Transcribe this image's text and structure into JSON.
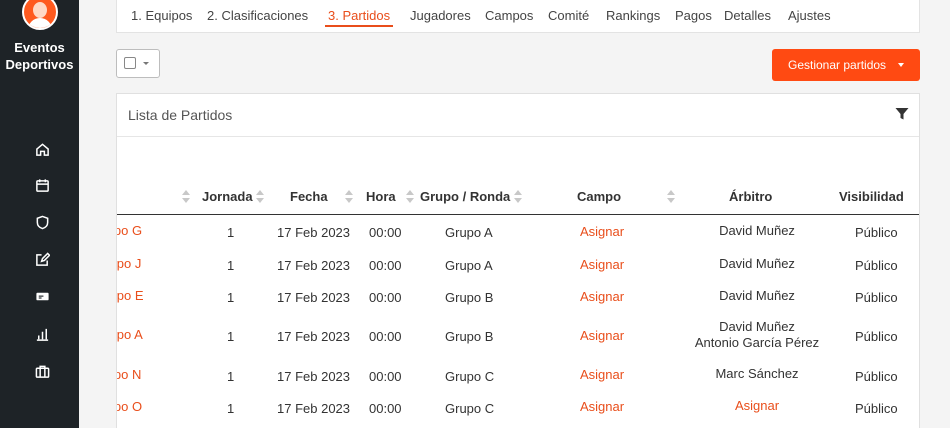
{
  "brand": {
    "name_line1": "Eventos",
    "name_line2": "Deportivos"
  },
  "sidebar": {
    "icons": [
      "home-icon",
      "calendar-icon",
      "shield-icon",
      "edit-icon",
      "ticket-icon",
      "bar-chart-icon",
      "briefcase-icon"
    ]
  },
  "tabs": [
    {
      "label": "1. Equipos",
      "active": false
    },
    {
      "label": "2. Clasificaciones",
      "active": false
    },
    {
      "label": "3. Partidos",
      "active": true
    },
    {
      "label": "Jugadores",
      "active": false
    },
    {
      "label": "Campos",
      "active": false
    },
    {
      "label": "Comité",
      "active": false
    },
    {
      "label": "Rankings",
      "active": false
    },
    {
      "label": "Pagos",
      "active": false
    },
    {
      "label": "Detalles",
      "active": false
    },
    {
      "label": "Ajustes",
      "active": false
    }
  ],
  "toolbar": {
    "manage_label": "Gestionar partidos"
  },
  "panel": {
    "title": "Lista de Partidos"
  },
  "table": {
    "columns": {
      "jornada": "Jornada",
      "fecha": "Fecha",
      "hora": "Hora",
      "grupo": "Grupo / Ronda",
      "campo": "Campo",
      "arbitro": "Árbitro",
      "visibilidad": "Visibilidad"
    },
    "rows": [
      {
        "team": "ipo G",
        "jornada": "1",
        "fecha": "17 Feb 2023",
        "hora": "00:00",
        "grupo": "Grupo A",
        "campo": "Asignar",
        "arbitro": "David Muñez",
        "visibilidad": "Público"
      },
      {
        "team": "iipo J",
        "jornada": "1",
        "fecha": "17 Feb 2023",
        "hora": "00:00",
        "grupo": "Grupo A",
        "campo": "Asignar",
        "arbitro": "David Muñez",
        "visibilidad": "Público"
      },
      {
        "team": "iipo E",
        "jornada": "1",
        "fecha": "17 Feb 2023",
        "hora": "00:00",
        "grupo": "Grupo B",
        "campo": "Asignar",
        "arbitro": "David Muñez",
        "visibilidad": "Público"
      },
      {
        "team": "iipo A",
        "jornada": "1",
        "fecha": "17 Feb 2023",
        "hora": "00:00",
        "grupo": "Grupo B",
        "campo": "Asignar",
        "arbitro": "David Muñez",
        "arbitro2": "Antonio García Pérez",
        "visibilidad": "Público"
      },
      {
        "team": "ipo N",
        "jornada": "1",
        "fecha": "17 Feb 2023",
        "hora": "00:00",
        "grupo": "Grupo C",
        "campo": "Asignar",
        "arbitro": "Marc Sánchez",
        "visibilidad": "Público"
      },
      {
        "team": "ipo O",
        "jornada": "1",
        "fecha": "17 Feb 2023",
        "hora": "00:00",
        "grupo": "Grupo C",
        "campo": "Asignar",
        "arbitro": "Asignar",
        "arbitro_is_link": true,
        "visibilidad": "Público"
      }
    ]
  },
  "colors": {
    "accent": "#ff4a12",
    "link": "#e94e1b",
    "sidebar": "#1e2327"
  }
}
